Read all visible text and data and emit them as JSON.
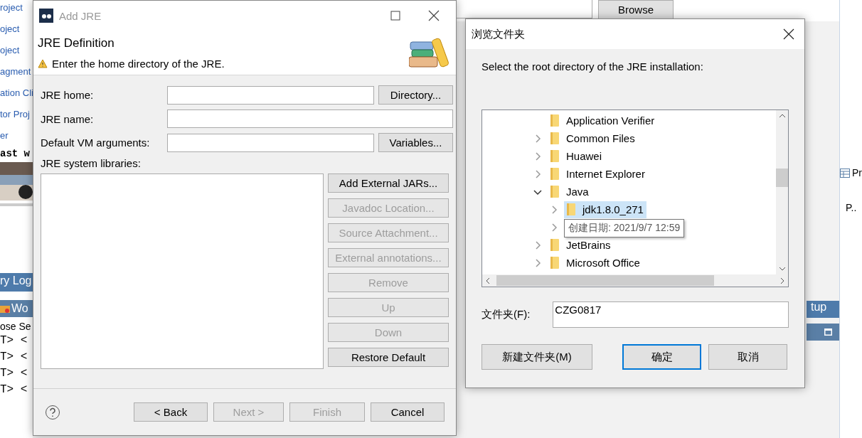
{
  "ide": {
    "left_links": [
      "roject",
      "oject",
      "oject",
      "agment",
      "ation Cli",
      "tor Proj",
      "er"
    ],
    "editor_text": "ast w",
    "thumbnail": {
      "kind": "picture"
    },
    "log_tab": "ry Log",
    "work_tab": "Wo",
    "servers_label": "ose Se",
    "console_lines": [
      "T>  <",
      "T>  <",
      "T>  <",
      "T>  <"
    ],
    "browse_button": "Browse",
    "setup_tab": "tup",
    "properties_tab": "Pr",
    "properties_column": "P.."
  },
  "add_jre": {
    "title": "Add JRE",
    "heading": "JRE Definition",
    "message": "Enter the home directory of the JRE.",
    "fields": [
      {
        "label": "JRE home:",
        "button": "Directory..."
      },
      {
        "label": "JRE name:"
      },
      {
        "label": "Default VM arguments:",
        "button": "Variables..."
      }
    ],
    "libraries_label": "JRE system libraries:",
    "library_buttons": [
      {
        "label": "Add External JARs...",
        "disabled": false
      },
      {
        "label": "Javadoc Location...",
        "disabled": true
      },
      {
        "label": "Source Attachment...",
        "disabled": true
      },
      {
        "label": "External annotations...",
        "disabled": true
      },
      {
        "label": "Remove",
        "disabled": true
      },
      {
        "label": "Up",
        "disabled": true
      },
      {
        "label": "Down",
        "disabled": true
      },
      {
        "label": "Restore Default",
        "disabled": false
      }
    ],
    "footer_buttons": [
      {
        "label": "< Back",
        "disabled": false
      },
      {
        "label": "Next >",
        "disabled": true
      },
      {
        "label": "Finish",
        "disabled": true
      },
      {
        "label": "Cancel",
        "disabled": false
      }
    ]
  },
  "browse": {
    "title": "浏览文件夹",
    "prompt": "Select the root directory of the JRE installation:",
    "tree": [
      {
        "label": "Application Verifier",
        "expandable": false,
        "selected": false
      },
      {
        "label": "Common Files",
        "expandable": true,
        "expanded": false,
        "selected": false
      },
      {
        "label": "Huawei",
        "expandable": true,
        "expanded": false,
        "selected": false
      },
      {
        "label": "Internet Explorer",
        "expandable": true,
        "expanded": false,
        "selected": false
      },
      {
        "label": "Java",
        "expandable": true,
        "expanded": true,
        "selected": false,
        "children": [
          {
            "label": "jdk1.8.0_271",
            "expandable": true,
            "expanded": false,
            "selected": true
          },
          {
            "expandable": true,
            "expanded": false,
            "selected": false
          }
        ]
      },
      {
        "label": "JetBrains",
        "expandable": true,
        "expanded": false,
        "selected": false
      },
      {
        "label": "Microsoft Office",
        "expandable": true,
        "expanded": false,
        "selected": false
      }
    ],
    "tooltip": "创建日期: 2021/9/7 12:59",
    "folder_label": "文件夹(F):",
    "folder_value": "CZG0817",
    "buttons": [
      {
        "label": "新建文件夹(M)",
        "default": false
      },
      {
        "label": "确定",
        "default": true
      },
      {
        "label": "取消",
        "default": false
      }
    ]
  }
}
